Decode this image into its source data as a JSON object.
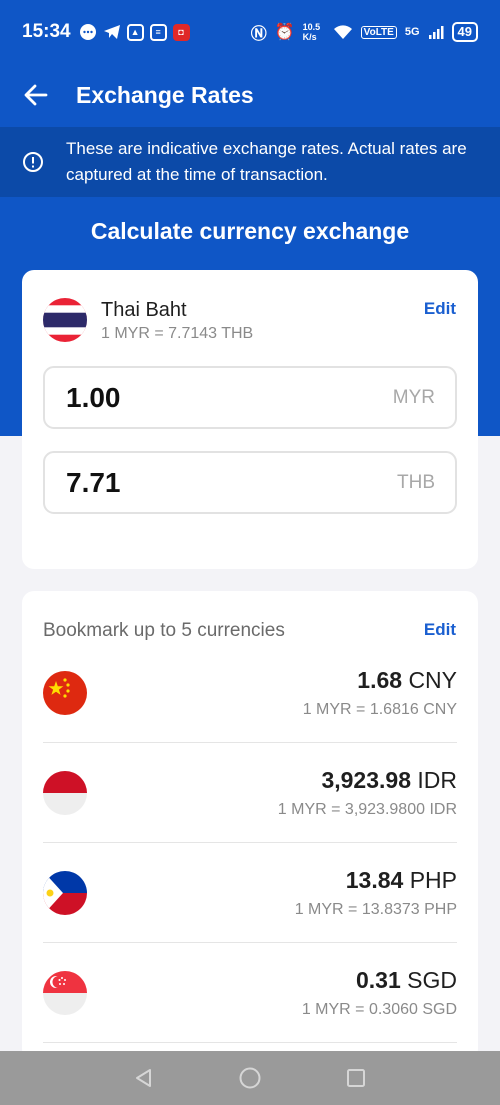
{
  "status_bar": {
    "time": "15:34",
    "network_speed": "10.5 K/s",
    "volte": "VoLTE",
    "signal": "5G",
    "battery": "49"
  },
  "header": {
    "title": "Exchange Rates",
    "back_icon": "arrow-left-icon"
  },
  "notice": {
    "icon": "info-circle-icon",
    "text": "These are indicative exchange rates. Actual rates are captured at the time of transaction."
  },
  "calculator": {
    "title": "Calculate currency exchange",
    "currency_name": "Thai Baht",
    "rate_text": "1 MYR = 7.7143 THB",
    "edit_label": "Edit",
    "from_value": "1.00",
    "from_code": "MYR",
    "to_value": "7.71",
    "to_code": "THB"
  },
  "bookmarks": {
    "title": "Bookmark up to 5 currencies",
    "edit_label": "Edit",
    "items": [
      {
        "flag": "china-flag-icon",
        "value": "1.68",
        "code": "CNY",
        "rate": "1 MYR = 1.6816 CNY"
      },
      {
        "flag": "indonesia-flag-icon",
        "value": "3,923.98",
        "code": "IDR",
        "rate": "1 MYR = 3,923.9800 IDR"
      },
      {
        "flag": "philippines-flag-icon",
        "value": "13.84",
        "code": "PHP",
        "rate": "1 MYR = 13.8373 PHP"
      },
      {
        "flag": "singapore-flag-icon",
        "value": "0.31",
        "code": "SGD",
        "rate": "1 MYR = 0.3060 SGD"
      }
    ]
  },
  "colors": {
    "primary": "#0f56c6",
    "notice_bg": "#0c4aa8",
    "link": "#1a5fd0",
    "page_bg": "#f3f3f7"
  },
  "nav_bar": {
    "back": "triangle-back-icon",
    "home": "circle-home-icon",
    "recents": "square-recents-icon"
  }
}
